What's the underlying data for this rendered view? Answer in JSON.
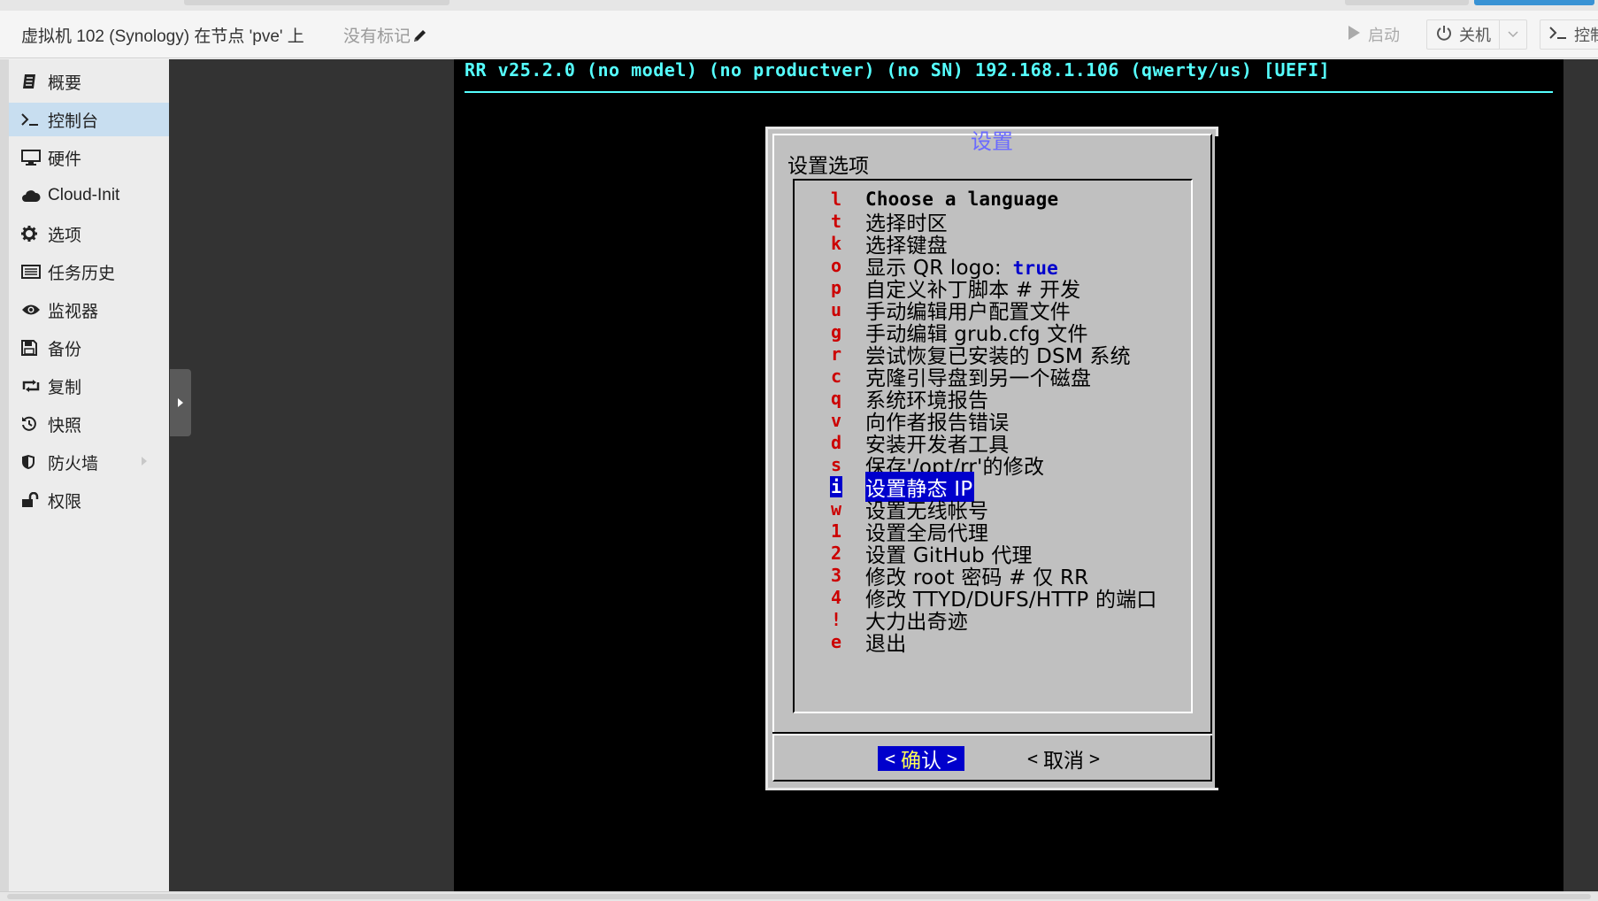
{
  "header": {
    "title": "虚拟机 102 (Synology) 在节点 'pve' 上",
    "tags": "没有标记",
    "start_label": "启动",
    "shutdown_label": "关机",
    "console_label": "控制"
  },
  "sidebar": {
    "items": [
      {
        "label": "概要",
        "icon": "summary-icon"
      },
      {
        "label": "控制台",
        "icon": "terminal-icon",
        "active": true
      },
      {
        "label": "硬件",
        "icon": "monitor-icon"
      },
      {
        "label": "Cloud-Init",
        "icon": "cloud-icon"
      },
      {
        "label": "选项",
        "icon": "gear-icon"
      },
      {
        "label": "任务历史",
        "icon": "list-icon"
      },
      {
        "label": "监视器",
        "icon": "eye-icon"
      },
      {
        "label": "备份",
        "icon": "save-icon"
      },
      {
        "label": "复制",
        "icon": "retweet-icon"
      },
      {
        "label": "快照",
        "icon": "history-icon"
      },
      {
        "label": "防火墙",
        "icon": "shield-icon"
      },
      {
        "label": "权限",
        "icon": "unlock-icon"
      }
    ]
  },
  "terminal": {
    "status_line": "RR v25.2.0 (no model) (no productver) (no SN) 192.168.1.106 (qwerty/us) [UEFI]",
    "dialog": {
      "title": "设置",
      "subtitle": "设置选项",
      "items": [
        {
          "key": "l",
          "label": "Choose a language"
        },
        {
          "key": "t",
          "label": "选择时区"
        },
        {
          "key": "k",
          "label": "选择键盘"
        },
        {
          "key": "o",
          "label": "显示 QR logo:",
          "value": "true"
        },
        {
          "key": "p",
          "label": "自定义补丁脚本 # 开发"
        },
        {
          "key": "u",
          "label": "手动编辑用户配置文件"
        },
        {
          "key": "g",
          "label": "手动编辑 grub.cfg 文件"
        },
        {
          "key": "r",
          "label": "尝试恢复已安装的 DSM 系统"
        },
        {
          "key": "c",
          "label": "克隆引导盘到另一个磁盘"
        },
        {
          "key": "q",
          "label": "系统环境报告"
        },
        {
          "key": "v",
          "label": "向作者报告错误"
        },
        {
          "key": "d",
          "label": "安装开发者工具"
        },
        {
          "key": "s",
          "label": "保存'/opt/rr'的修改"
        },
        {
          "key": "i",
          "label": "设置静态 IP",
          "selected": true
        },
        {
          "key": "w",
          "label": "设置无线帐号"
        },
        {
          "key": "1",
          "label": "设置全局代理"
        },
        {
          "key": "2",
          "label": "设置 GitHub 代理"
        },
        {
          "key": "3",
          "label": "修改 root 密码 # 仅 RR"
        },
        {
          "key": "4",
          "label": "修改 TTYD/DUFS/HTTP 的端口"
        },
        {
          "key": "!",
          "label": "大力出奇迹"
        },
        {
          "key": "e",
          "label": "退出"
        }
      ],
      "ok_first": "确",
      "ok_rest": "认",
      "cancel_label": "取消"
    }
  },
  "colors": {
    "accent": "#3892d4",
    "active_nav": "#c8def0",
    "term_cyan": "#55ffff",
    "dialog_gray": "#c0c0c0",
    "selection_blue": "#0000cc",
    "hotkey_red": "#cc0000"
  }
}
